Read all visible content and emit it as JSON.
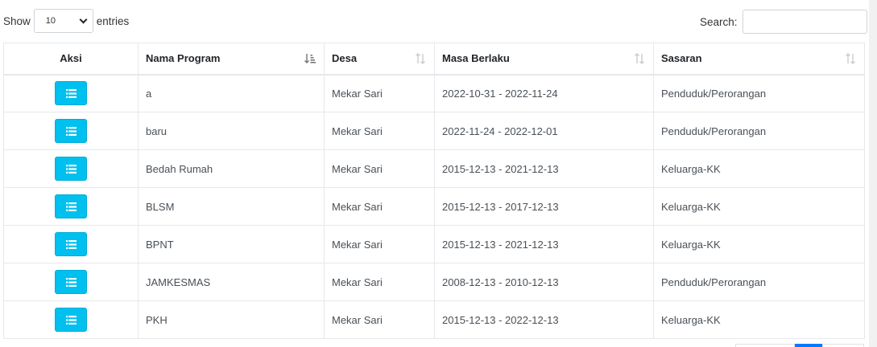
{
  "length": {
    "show_label": "Show",
    "selected": "10",
    "entries_label": "entries"
  },
  "search": {
    "label": "Search:",
    "value": "",
    "placeholder": ""
  },
  "table": {
    "columns": [
      {
        "label": "Aksi"
      },
      {
        "label": "Nama Program"
      },
      {
        "label": "Desa"
      },
      {
        "label": "Masa Berlaku"
      },
      {
        "label": "Sasaran"
      }
    ],
    "rows": [
      {
        "nama": "a",
        "desa": "Mekar Sari",
        "masa": "2022-10-31 - 2022-11-24",
        "sasaran": "Penduduk/Perorangan"
      },
      {
        "nama": "baru",
        "desa": "Mekar Sari",
        "masa": "2022-11-24 - 2022-12-01",
        "sasaran": "Penduduk/Perorangan"
      },
      {
        "nama": "Bedah Rumah",
        "desa": "Mekar Sari",
        "masa": "2015-12-13 - 2021-12-13",
        "sasaran": "Keluarga-KK"
      },
      {
        "nama": "BLSM",
        "desa": "Mekar Sari",
        "masa": "2015-12-13 - 2017-12-13",
        "sasaran": "Keluarga-KK"
      },
      {
        "nama": "BPNT",
        "desa": "Mekar Sari",
        "masa": "2015-12-13 - 2021-12-13",
        "sasaran": "Keluarga-KK"
      },
      {
        "nama": "JAMKESMAS",
        "desa": "Mekar Sari",
        "masa": "2008-12-13 - 2010-12-13",
        "sasaran": "Penduduk/Perorangan"
      },
      {
        "nama": "PKH",
        "desa": "Mekar Sari",
        "masa": "2015-12-13 - 2022-12-13",
        "sasaran": "Keluarga-KK"
      }
    ]
  },
  "icons": {
    "row_button": "list-icon",
    "sort_active": "sort-asc-icon",
    "sort_idle": "sort-both-icon"
  },
  "colors": {
    "button_bg": "#00c0ef",
    "pager_active": "#007bff"
  }
}
